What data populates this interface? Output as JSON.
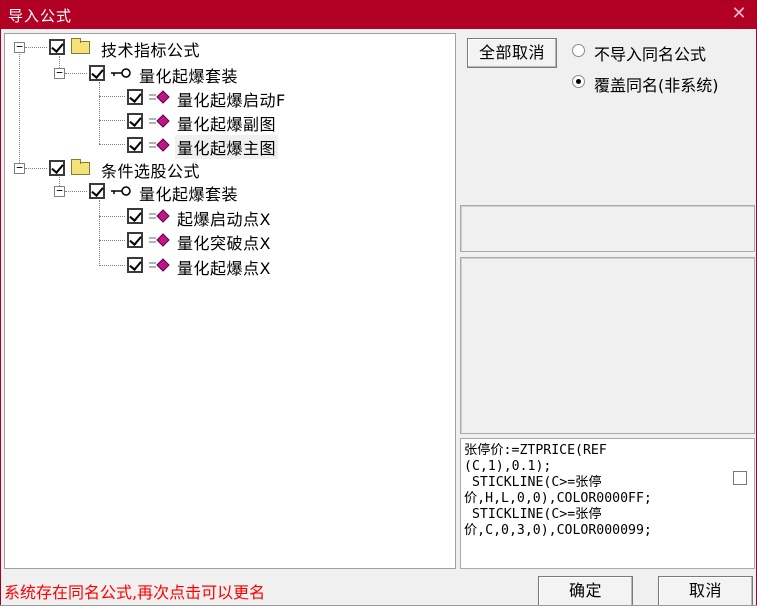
{
  "window": {
    "title": "导入公式",
    "close_glyph": "✕"
  },
  "tree": {
    "group1": {
      "label": "技术指标公式",
      "set": {
        "label": "量化起爆套装",
        "items": [
          "量化起爆启动F",
          "量化起爆副图",
          "量化起爆主图"
        ]
      }
    },
    "group2": {
      "label": "条件选股公式",
      "set": {
        "label": "量化起爆套装",
        "items": [
          "起爆启动点X",
          "量化突破点X",
          "量化起爆点X"
        ]
      }
    },
    "expander_glyph": "−"
  },
  "options": {
    "cancel_all_label": "全部取消",
    "radio_skip_label": "不导入同名公式",
    "radio_overwrite_label": "覆盖同名(非系统)",
    "selected": "overwrite"
  },
  "code": {
    "text": "张停价:=ZTPRICE(REF\n(C,1),0.1);\n STICKLINE(C>=张停\n价,H,L,0,0),COLOR0000FF;\n STICKLINE(C>=张停\n价,C,0,3,0),COLOR000099;"
  },
  "status_text": "系统存在同名公式,再次点击可以更名",
  "buttons": {
    "ok_label": "确定",
    "cancel_label": "取消"
  },
  "colors": {
    "titlebar": "#b10023",
    "status": "#ff0000",
    "formula_icon": "#c0158a"
  }
}
